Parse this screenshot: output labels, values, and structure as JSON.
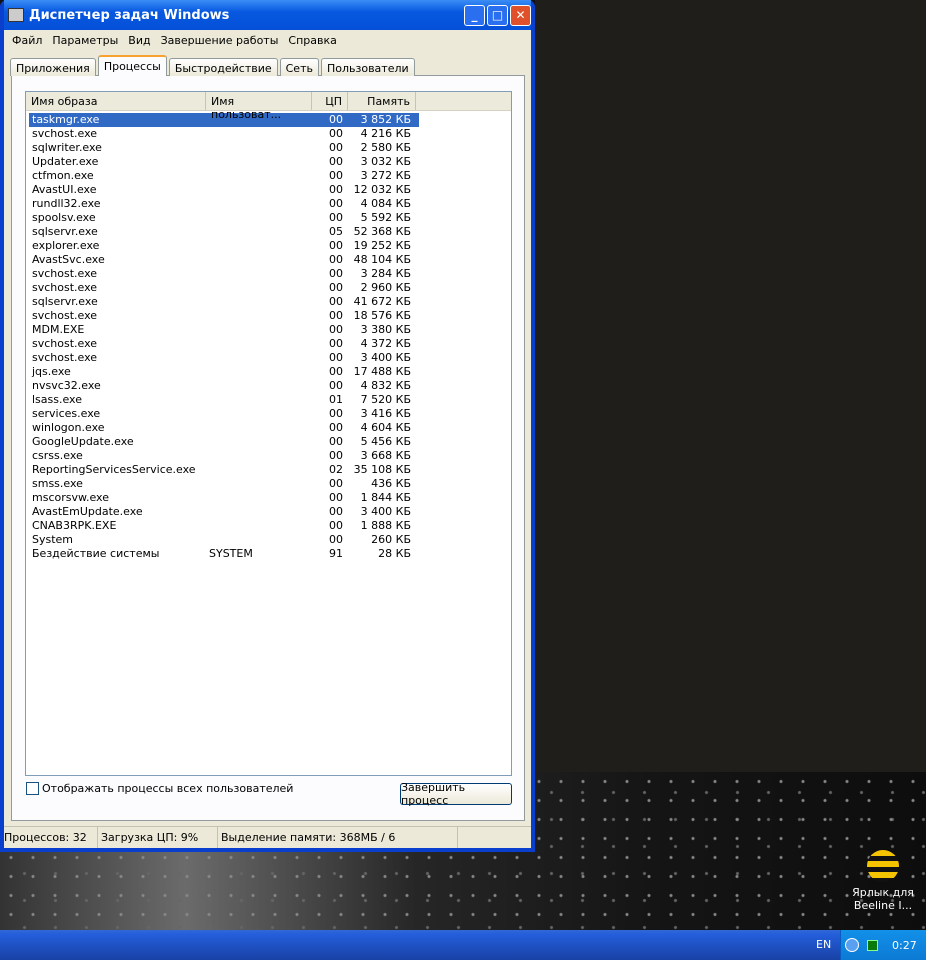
{
  "window": {
    "title": "Диспетчер задач Windows",
    "minimize": "_",
    "maximize": "□",
    "close": "✕"
  },
  "menu": [
    "Файл",
    "Параметры",
    "Вид",
    "Завершение работы",
    "Справка"
  ],
  "tabs": [
    "Приложения",
    "Процессы",
    "Быстродействие",
    "Сеть",
    "Пользователи"
  ],
  "columns": [
    "Имя образа",
    "Имя пользоват...",
    "ЦП",
    "Память"
  ],
  "rows": [
    [
      "taskmgr.exe",
      "",
      "00",
      "3 852 КБ"
    ],
    [
      "svchost.exe",
      "",
      "00",
      "4 216 КБ"
    ],
    [
      "sqlwriter.exe",
      "",
      "00",
      "2 580 КБ"
    ],
    [
      "Updater.exe",
      "",
      "00",
      "3 032 КБ"
    ],
    [
      "ctfmon.exe",
      "",
      "00",
      "3 272 КБ"
    ],
    [
      "AvastUI.exe",
      "",
      "00",
      "12 032 КБ"
    ],
    [
      "rundll32.exe",
      "",
      "00",
      "4 084 КБ"
    ],
    [
      "spoolsv.exe",
      "",
      "00",
      "5 592 КБ"
    ],
    [
      "sqlservr.exe",
      "",
      "05",
      "52 368 КБ"
    ],
    [
      "explorer.exe",
      "",
      "00",
      "19 252 КБ"
    ],
    [
      "AvastSvc.exe",
      "",
      "00",
      "48 104 КБ"
    ],
    [
      "svchost.exe",
      "",
      "00",
      "3 284 КБ"
    ],
    [
      "svchost.exe",
      "",
      "00",
      "2 960 КБ"
    ],
    [
      "sqlservr.exe",
      "",
      "00",
      "41 672 КБ"
    ],
    [
      "svchost.exe",
      "",
      "00",
      "18 576 КБ"
    ],
    [
      "MDM.EXE",
      "",
      "00",
      "3 380 КБ"
    ],
    [
      "svchost.exe",
      "",
      "00",
      "4 372 КБ"
    ],
    [
      "svchost.exe",
      "",
      "00",
      "3 400 КБ"
    ],
    [
      "jqs.exe",
      "",
      "00",
      "17 488 КБ"
    ],
    [
      "nvsvc32.exe",
      "",
      "00",
      "4 832 КБ"
    ],
    [
      "lsass.exe",
      "",
      "01",
      "7 520 КБ"
    ],
    [
      "services.exe",
      "",
      "00",
      "3 416 КБ"
    ],
    [
      "winlogon.exe",
      "",
      "00",
      "4 604 КБ"
    ],
    [
      "GoogleUpdate.exe",
      "",
      "00",
      "5 456 КБ"
    ],
    [
      "csrss.exe",
      "",
      "00",
      "3 668 КБ"
    ],
    [
      "ReportingServicesService.exe",
      "",
      "02",
      "35 108 КБ"
    ],
    [
      "smss.exe",
      "",
      "00",
      "436 КБ"
    ],
    [
      "mscorsvw.exe",
      "",
      "00",
      "1 844 КБ"
    ],
    [
      "AvastEmUpdate.exe",
      "",
      "00",
      "3 400 КБ"
    ],
    [
      "CNAB3RPK.EXE",
      "",
      "00",
      "1 888 КБ"
    ],
    [
      "System",
      "",
      "00",
      "260 КБ"
    ],
    [
      "Бездействие системы",
      "SYSTEM",
      "91",
      "28 КБ"
    ]
  ],
  "show_all_label": "Отображать процессы всех пользователей",
  "end_process_label": "Завершить процесс",
  "status": {
    "processes": "Процессов: 32",
    "cpu": "Загрузка ЦП: 9%",
    "memory": "Выделение памяти: 368МБ / 6"
  },
  "desktop_icon": "Ярлык для Beeline I...",
  "taskbar": {
    "lang": "EN",
    "clock": "0:27"
  }
}
